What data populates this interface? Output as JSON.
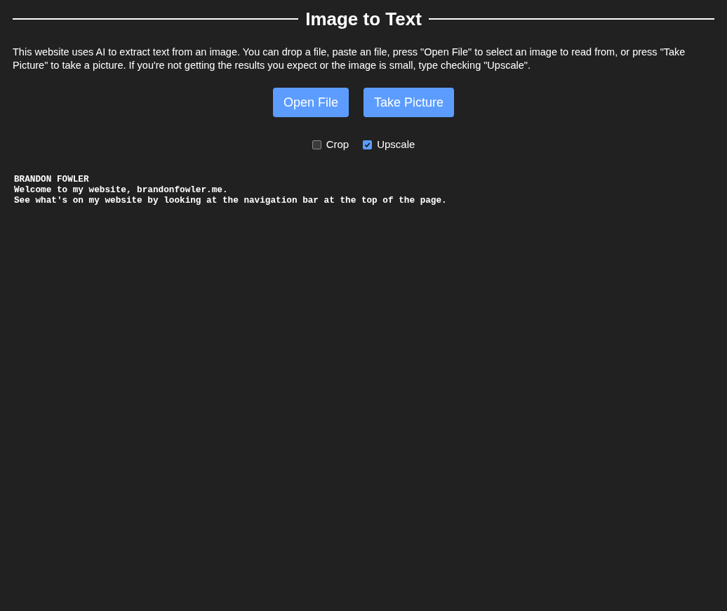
{
  "title": "Image to Text",
  "description": "This website uses AI to extract text from an image. You can drop a file, paste an file, press \"Open File\" to select an image to read from, or press \"Take Picture\" to take a picture. If you're not getting the results you expect or the image is small, type checking \"Upscale\".",
  "buttons": [
    "Open File",
    "Take Picture"
  ],
  "options": [
    {
      "label": "Crop",
      "checked": false
    },
    {
      "label": "Upscale",
      "checked": true
    }
  ],
  "output_lines": [
    "BRANDON FOWLER",
    "Welcome to my website, brandonfowler.me.",
    "See what's on my website by looking at the navigation bar at the top of the page."
  ]
}
